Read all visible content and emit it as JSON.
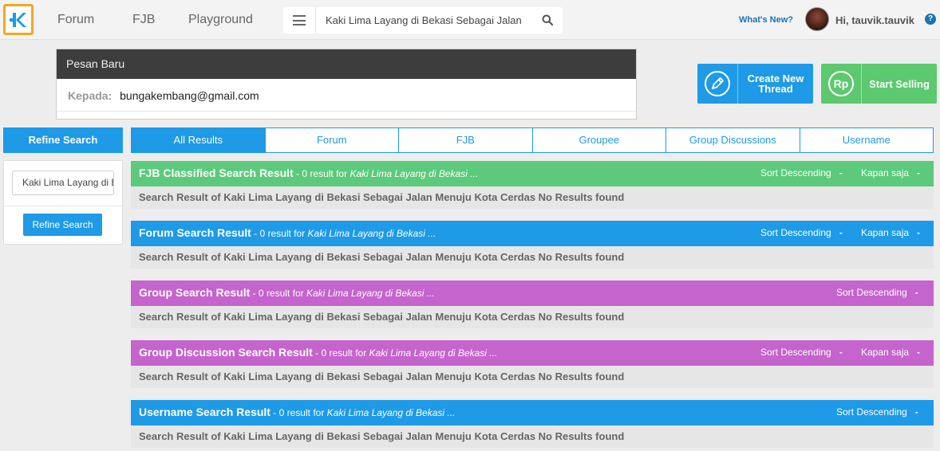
{
  "nav": {
    "forum": "Forum",
    "fjb": "FJB",
    "playground": "Playground"
  },
  "search": {
    "value": "Kaki Lima Layang di Bekasi Sebagai Jalan Me"
  },
  "header_right": {
    "whats_new": "What's New?",
    "greeting": "Hi, tauvik.tauvik",
    "help": "?"
  },
  "message": {
    "title": "Pesan Baru",
    "to_label": "Kepada:",
    "to_value": "bungakembang@gmail.com"
  },
  "actions": {
    "create_line1": "Create New",
    "create_line2": "Thread",
    "sell": "Start Selling",
    "sell_icon_text": "Rp"
  },
  "sidebar": {
    "header": "Refine Search",
    "input_value": "Kaki Lima Layang di Bekasi",
    "button": "Refine Search"
  },
  "tabs": [
    {
      "label": "All Results",
      "active": true
    },
    {
      "label": "Forum",
      "active": false
    },
    {
      "label": "FJB",
      "active": false
    },
    {
      "label": "Groupee",
      "active": false
    },
    {
      "label": "Group Discussions",
      "active": false
    },
    {
      "label": "Username",
      "active": false
    }
  ],
  "sections": [
    {
      "title": "FJB Classified Search Result",
      "count": " - 0 result for ",
      "query": "Kaki Lima Layang di Bekasi ...",
      "sort": "Sort Descending",
      "time": "Kapan saja",
      "body": "Search Result of Kaki Lima Layang di Bekasi Sebagai Jalan Menuju Kota Cerdas No Results found",
      "color": "#5cc97b"
    },
    {
      "title": "Forum Search Result",
      "count": " - 0 result for ",
      "query": "Kaki Lima Layang di Bekasi ...",
      "sort": "Sort Descending",
      "time": "Kapan saja",
      "body": "Search Result of Kaki Lima Layang di Bekasi Sebagai Jalan Menuju Kota Cerdas No Results found",
      "color": "#1e9ae6"
    },
    {
      "title": "Group Search Result",
      "count": " - 0 result for ",
      "query": "Kaki Lima Layang di Bekasi ...",
      "sort": "Sort Descending",
      "time": "",
      "body": "Search Result of Kaki Lima Layang di Bekasi Sebagai Jalan Menuju Kota Cerdas No Results found",
      "color": "#c464cc"
    },
    {
      "title": "Group Discussion Search Result",
      "count": " - 0 result for ",
      "query": "Kaki Lima Layang di Bekasi ...",
      "sort": "Sort Descending",
      "time": "Kapan saja",
      "body": "Search Result of Kaki Lima Layang di Bekasi Sebagai Jalan Menuju Kota Cerdas No Results found",
      "color": "#c464cc"
    },
    {
      "title": "Username Search Result",
      "count": " - 0 result for ",
      "query": "Kaki Lima Layang di Bekasi ...",
      "sort": "Sort Descending",
      "time": "",
      "body": "Search Result of Kaki Lima Layang di Bekasi Sebagai Jalan Menuju Kota Cerdas No Results found",
      "color": "#1e9ae6"
    }
  ],
  "colors": {
    "primary": "#1e9ae6",
    "success": "#5cc96e",
    "logo_border": "#f5a623"
  }
}
